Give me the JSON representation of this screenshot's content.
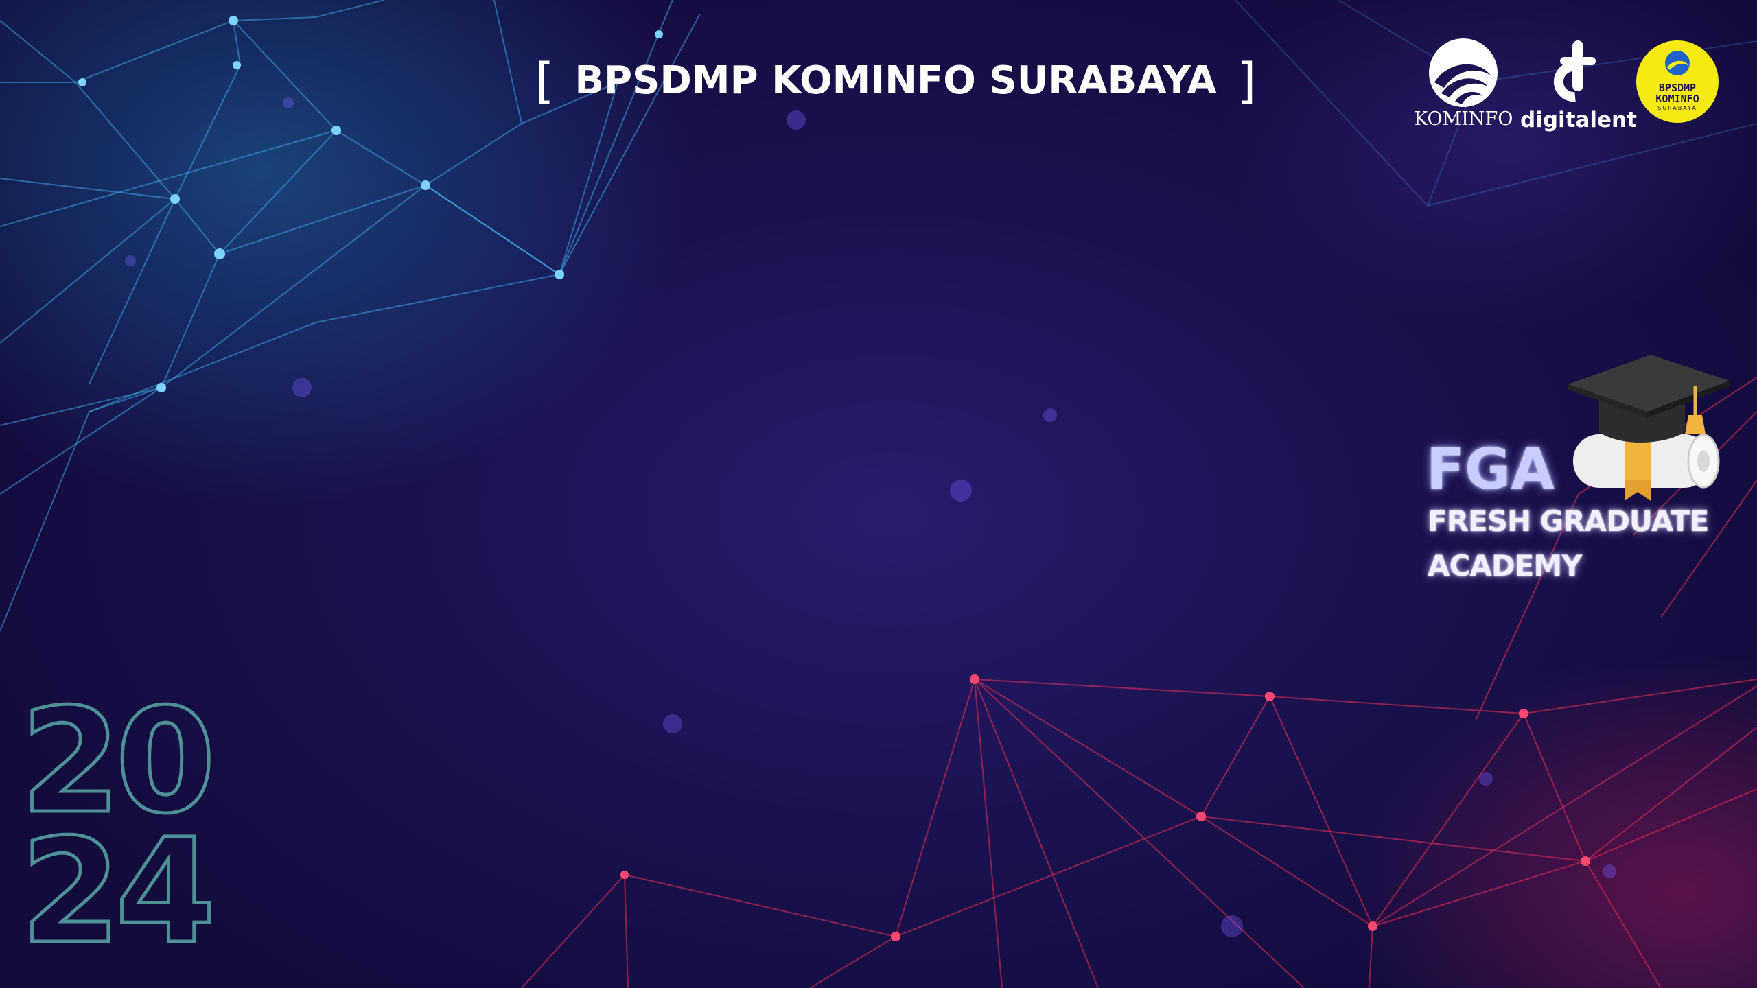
{
  "header": {
    "bracket_open": "[",
    "title": "BPSDMP KOMINFO SURABAYA",
    "bracket_close": "]"
  },
  "logos": {
    "kominfo": {
      "icon": "kominfo-wave-icon",
      "label": "KOMINFO"
    },
    "digitalent": {
      "icon": "digitalent-icon",
      "label": "digitalent"
    },
    "bpsdmp": {
      "icon": "bpsdmp-badge-icon",
      "line1": "BPSDMP",
      "line2": "KOMINFO",
      "line3": "SURABAYA"
    }
  },
  "program": {
    "abbr": "FGA",
    "line1": "FRESH GRADUATE",
    "line2": "ACADEMY",
    "icon": "graduation-cap-diploma-icon"
  },
  "year": {
    "line1": "20",
    "line2": "24"
  },
  "colors": {
    "background": "#1b1352",
    "network_top": "#3aa6e0",
    "network_bottom": "#e0294f",
    "year_outline": "#4f8f98",
    "badge_yellow": "#f6ea12",
    "fga_glow": "#c8ccff"
  }
}
